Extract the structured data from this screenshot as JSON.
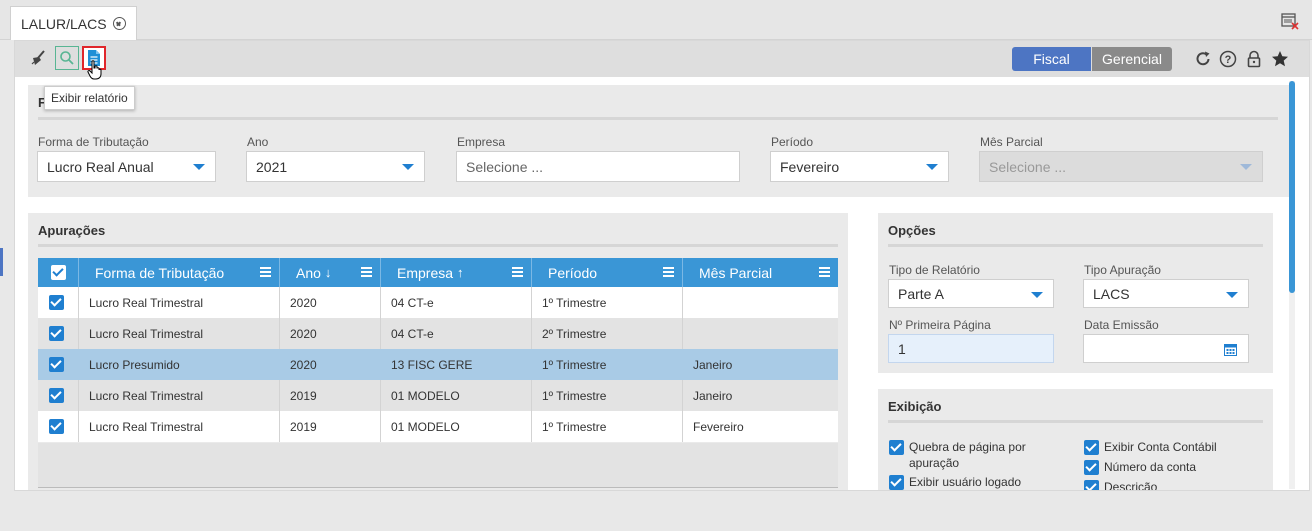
{
  "tab": {
    "label": "LALUR/LACS"
  },
  "toolbar": {
    "tooltip": "Exibir relatório",
    "fiscal": "Fiscal",
    "gerencial": "Gerencial"
  },
  "filter": {
    "title": "F",
    "forma_label": "Forma de Tributação",
    "forma_value": "Lucro Real Anual",
    "ano_label": "Ano",
    "ano_value": "2021",
    "empresa_label": "Empresa",
    "empresa_placeholder": "Selecione ...",
    "periodo_label": "Período",
    "periodo_value": "Fevereiro",
    "mes_label": "Mês Parcial",
    "mes_placeholder": "Selecione ..."
  },
  "apuracoes": {
    "title": "Apurações",
    "columns": [
      "Forma de Tributação",
      "Ano",
      "Empresa",
      "Período",
      "Mês Parcial"
    ],
    "rows": [
      [
        "Lucro Real Trimestral",
        "2020",
        "04 CT-e",
        "1º Trimestre",
        ""
      ],
      [
        "Lucro Real Trimestral",
        "2020",
        "04 CT-e",
        "2º Trimestre",
        ""
      ],
      [
        "Lucro Presumido",
        "2020",
        "13 FISC GERE",
        "1º Trimestre",
        "Janeiro"
      ],
      [
        "Lucro Real Trimestral",
        "2019",
        "01 MODELO",
        "1º Trimestre",
        "Janeiro"
      ],
      [
        "Lucro Real Trimestral",
        "2019",
        "01 MODELO",
        "1º Trimestre",
        "Fevereiro"
      ]
    ]
  },
  "opcoes": {
    "title": "Opções",
    "tipo_relatorio_label": "Tipo de Relatório",
    "tipo_relatorio_value": "Parte A",
    "tipo_apuracao_label": "Tipo Apuração",
    "tipo_apuracao_value": "LACS",
    "primeira_pagina_label": "Nº Primeira Página",
    "primeira_pagina_value": "1",
    "data_emissao_label": "Data Emissão",
    "data_emissao_value": ""
  },
  "exibicao": {
    "title": "Exibição",
    "quebra": "Quebra de página por apuração",
    "usuario": "Exibir usuário logado",
    "conta_contabil": "Exibir Conta Contábil",
    "numero_conta": "Número da conta",
    "descricao": "Descrição"
  },
  "colors": {
    "accent": "#3a96d6",
    "fiscal": "#4d75c3",
    "gerencial": "#8a8a8a",
    "selected_row": "#a9cbe6"
  },
  "icons": [
    "close-circle-icon",
    "close-window-icon",
    "broom-icon",
    "search-icon",
    "report-icon",
    "hand-cursor-icon",
    "refresh-icon",
    "help-icon",
    "lock-icon",
    "star-icon",
    "sort-down-icon",
    "sort-up-icon",
    "column-menu-icon",
    "calendar-icon",
    "chevron-down-icon"
  ]
}
